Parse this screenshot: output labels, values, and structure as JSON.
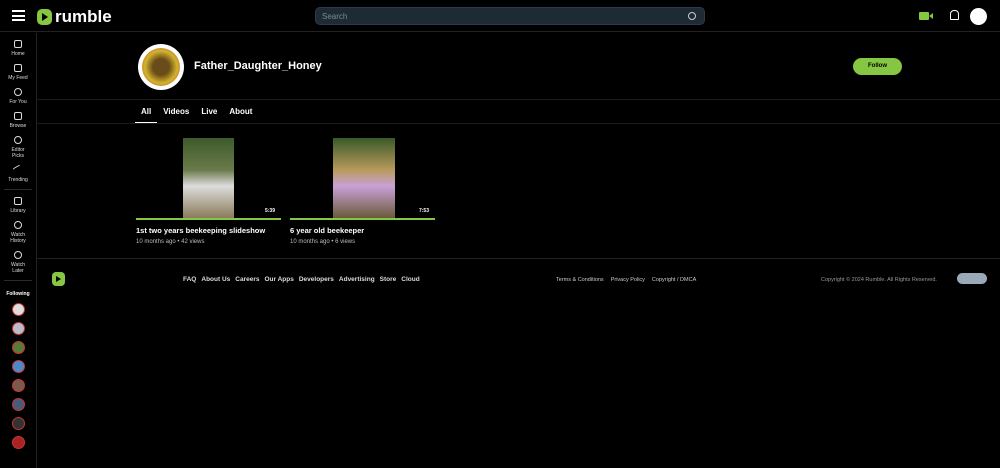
{
  "header": {
    "logo": "rumble",
    "search_placeholder": "Search"
  },
  "sidebar": {
    "items": [
      {
        "label": "Home",
        "icon": "home-icon"
      },
      {
        "label": "My Feed",
        "icon": "feed-icon"
      },
      {
        "label": "For You",
        "icon": "for-you-icon"
      },
      {
        "label": "Browse",
        "icon": "browse-icon"
      },
      {
        "label": "Editor Picks",
        "icon": "award-icon"
      },
      {
        "label": "Trending",
        "icon": "trending-icon"
      }
    ],
    "items2": [
      {
        "label": "Library",
        "icon": "library-icon"
      },
      {
        "label": "Watch History",
        "icon": "history-icon"
      },
      {
        "label": "Watch Later",
        "icon": "clock-icon"
      }
    ],
    "following_label": "Following"
  },
  "channel": {
    "name": "Father_Daughter_Honey",
    "follow_label": "Follow"
  },
  "tabs": [
    "All",
    "Videos",
    "Live",
    "About"
  ],
  "videos": [
    {
      "title": "1st two years beekeeping slideshow",
      "meta": "10 months ago • 42 views",
      "duration": "5:39"
    },
    {
      "title": "6 year old beekeeper",
      "meta": "10 months ago • 6 views",
      "duration": "7:53"
    }
  ],
  "footer": {
    "links": [
      "FAQ",
      "About Us",
      "Careers",
      "Our Apps",
      "Developers",
      "Advertising",
      "Store",
      "Cloud"
    ],
    "legal": [
      "Terms & Conditions",
      "Privacy Policy",
      "Copyright / DMCA"
    ],
    "copyright": "Copyright © 2024 Rumble. All Rights Reserved."
  },
  "colors": {
    "accent": "#85c742",
    "background": "#000000"
  }
}
